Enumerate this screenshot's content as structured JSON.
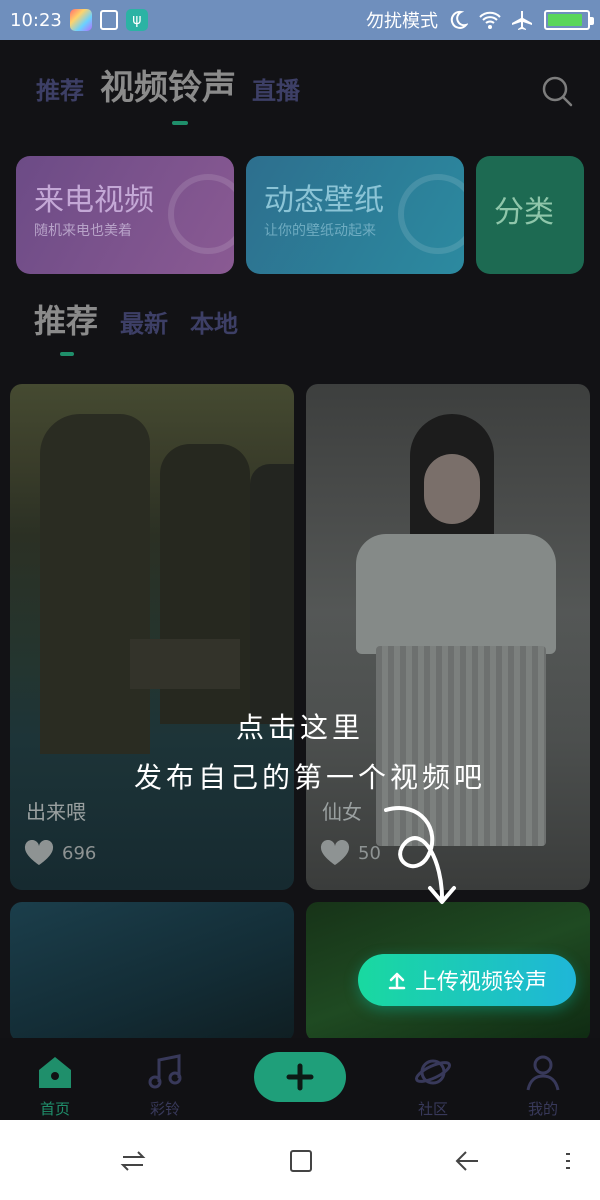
{
  "status_bar": {
    "time": "10:23",
    "dnd_label": "勿扰模式",
    "battery_level": 0.9
  },
  "top_tabs": [
    {
      "label": "推荐",
      "active": false
    },
    {
      "label": "视频铃声",
      "active": true
    },
    {
      "label": "直播",
      "active": false
    }
  ],
  "category_cards": [
    {
      "title": "来电视频",
      "subtitle": "随机来电也美着",
      "color": "#6c4b86"
    },
    {
      "title": "动态壁纸",
      "subtitle": "让你的壁纸动起来",
      "color": "#2d6f8e"
    },
    {
      "title": "分类",
      "subtitle": "",
      "color": "#1d6a52"
    }
  ],
  "sub_tabs": [
    {
      "label": "推荐",
      "active": true
    },
    {
      "label": "最新",
      "active": false
    },
    {
      "label": "本地",
      "active": false
    }
  ],
  "videos": [
    {
      "title": "出来喂",
      "likes": "696"
    },
    {
      "title": "仙女",
      "likes": "50"
    },
    {
      "title": "",
      "likes": ""
    },
    {
      "title": "",
      "likes": ""
    }
  ],
  "hint": {
    "line1": "点击这里",
    "line2": "发布自己的第一个视频吧"
  },
  "upload_button": {
    "label": "上传视频铃声",
    "icon": "upload-arrow-icon"
  },
  "bottom_nav": [
    {
      "label": "首页",
      "icon": "home-icon",
      "active": true
    },
    {
      "label": "彩铃",
      "icon": "music-note-icon",
      "active": false
    },
    {
      "label": "",
      "icon": "plus-icon",
      "active": false
    },
    {
      "label": "社区",
      "icon": "planet-icon",
      "active": false
    },
    {
      "label": "我的",
      "icon": "person-icon",
      "active": false
    }
  ],
  "colors": {
    "accent": "#1f9f7a",
    "upload_gradient_start": "#19d9a0",
    "upload_gradient_end": "#1fb6d8",
    "status_bar": "#6f8fbd"
  }
}
